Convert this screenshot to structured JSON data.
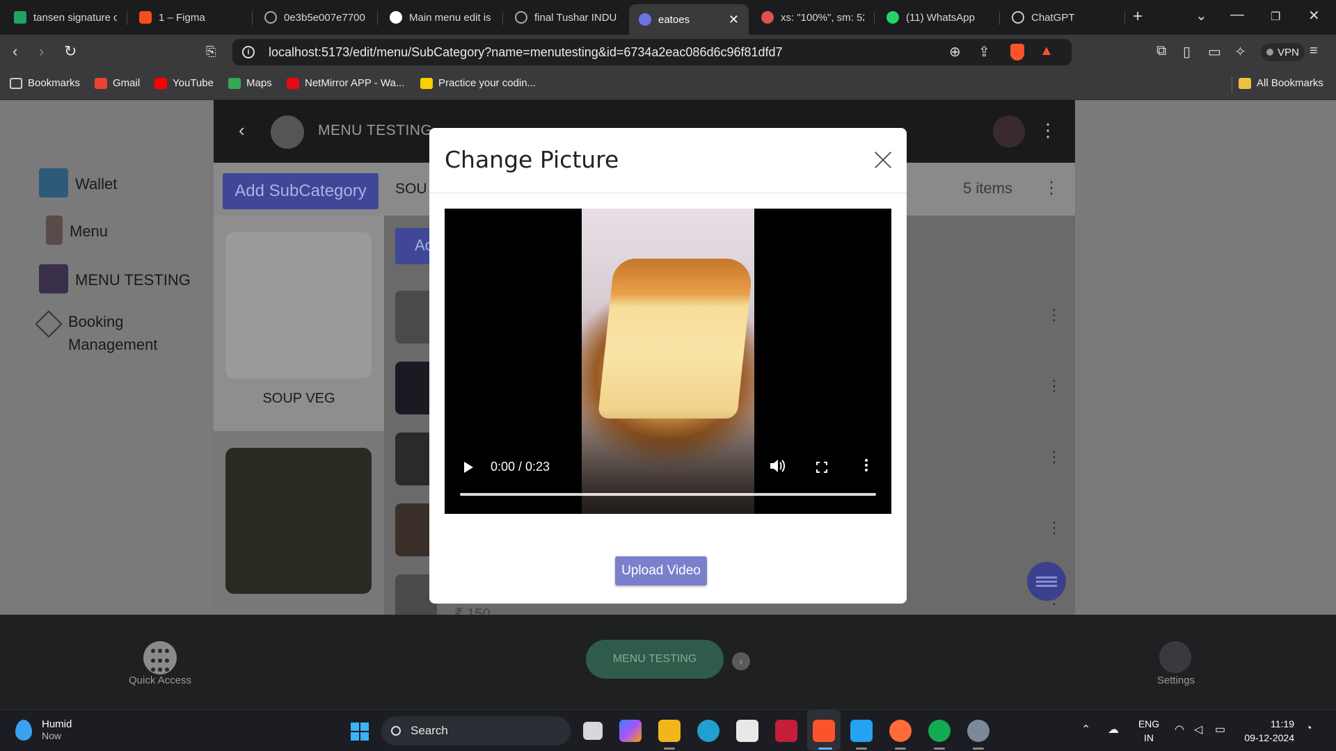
{
  "browser": {
    "tabs": [
      {
        "title": "tansen signature c",
        "color": "#1fa463"
      },
      {
        "title": "1 – Figma",
        "color": "#f24e1e"
      },
      {
        "title": "0e3b5e007e7700",
        "color": "#aaaaaa"
      },
      {
        "title": "Main menu edit is",
        "color": "#ffffff"
      },
      {
        "title": "final Tushar INDU",
        "color": "#aaaaaa"
      },
      {
        "title": "eatoes",
        "color": "#6b74e6",
        "active": true
      },
      {
        "title": "xs: \"100%\", sm: 52",
        "color": "#e05050"
      },
      {
        "title": "(11) WhatsApp",
        "color": "#25d366"
      },
      {
        "title": "ChatGPT",
        "color": "#cccccc"
      }
    ],
    "active_tab_close": "✕",
    "new_tab": "+",
    "url": "localhost:5173/edit/menu/SubCategory?name=menutesting&id=6734a2eac086d6c96f81dfd7",
    "vpn_label": "VPN",
    "bookmarks": [
      {
        "label": "Bookmarks",
        "color": "#cccccc"
      },
      {
        "label": "Gmail",
        "color": "#ea4335"
      },
      {
        "label": "YouTube",
        "color": "#ff0000"
      },
      {
        "label": "Maps",
        "color": "#34a853"
      },
      {
        "label": "NetMirror APP - Wa...",
        "color": "#e50914"
      },
      {
        "label": "Practice your codin...",
        "color": "#f7d100"
      }
    ],
    "all_bookmarks": "All Bookmarks"
  },
  "sidebar": {
    "items": [
      {
        "label": "Wallet"
      },
      {
        "label": "Menu"
      },
      {
        "label": "MENU TESTING"
      },
      {
        "label": "Booking Management"
      }
    ]
  },
  "app": {
    "header_title": "MENU TESTING",
    "add_subcategory": "Add SubCategory",
    "section_title": "SOU",
    "items_count": "5 items",
    "add_item_partial": "Ac",
    "categories": [
      {
        "label": "SOUP VEG"
      }
    ],
    "price_partial": "₹ 150"
  },
  "modal": {
    "title": "Change Picture",
    "video_time": "0:00 / 0:23",
    "upload_button": "Upload Video"
  },
  "bottom_nav": {
    "quick_access": "Quick Access",
    "center_pill": "MENU TESTING",
    "settings": "Settings"
  },
  "taskbar": {
    "weather_title": "Humid",
    "weather_sub": "Now",
    "search": "Search",
    "lang_line1": "ENG",
    "lang_line2": "IN",
    "time": "11:19",
    "date": "09-12-2024"
  }
}
